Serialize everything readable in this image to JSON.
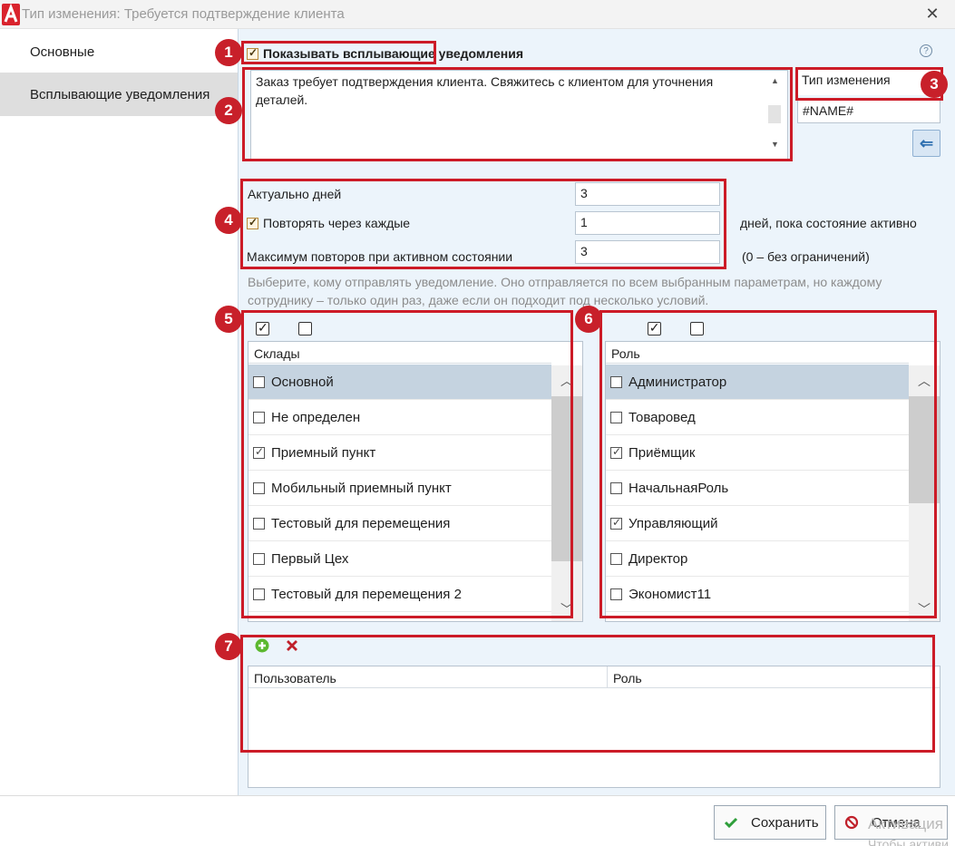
{
  "window": {
    "title": "Тип изменения: Требуется подтверждение клиента",
    "close_glyph": "✕"
  },
  "nav": {
    "items": [
      {
        "label": "Основные"
      },
      {
        "label": "Всплывающие уведомления"
      }
    ]
  },
  "main": {
    "show_popups_label": "Показывать всплывающие уведомления",
    "show_popups_checked": true,
    "help_glyph": "?",
    "message_text": "Заказ требует подтверждения клиента. Свяжитесь с клиентом для уточнения деталей.",
    "field_list": [
      "Тип изменения",
      "#NAME#"
    ],
    "insert_glyph": "⇐",
    "actual_days_label": "Актуально дней",
    "actual_days_value": "3",
    "repeat_label": "Повторять через каждые",
    "repeat_checked": true,
    "repeat_value": "1",
    "repeat_suffix": "дней, пока состояние активно",
    "max_repeats_label": "Максимум повторов при активном состоянии",
    "max_repeats_value": "3",
    "max_repeats_hint": "(0 – без ограничений)",
    "recipients_hint_line1": "Выберите, кому отправлять уведомление. Оно отправляется по всем выбранным параметрам, но каждому",
    "recipients_hint_line2": "сотруднику – только один раз, даже если он подходит под несколько условий."
  },
  "warehouses": {
    "header": "Склады",
    "rows": [
      {
        "label": "Основной",
        "checked": false,
        "selected": true
      },
      {
        "label": "Не определен",
        "checked": false
      },
      {
        "label": "Приемный пункт",
        "checked": true
      },
      {
        "label": "Мобильный приемный пункт",
        "checked": false
      },
      {
        "label": "Тестовый для перемещения",
        "checked": false
      },
      {
        "label": "Первый Цех",
        "checked": false
      },
      {
        "label": "Тестовый для перемещения 2",
        "checked": false
      }
    ]
  },
  "roles": {
    "header": "Роль",
    "rows": [
      {
        "label": "Администратор",
        "checked": false,
        "selected": true
      },
      {
        "label": "Товаровед",
        "checked": false
      },
      {
        "label": "Приёмщик",
        "checked": true
      },
      {
        "label": "НачальнаяРоль",
        "checked": false
      },
      {
        "label": "Управляющий",
        "checked": true
      },
      {
        "label": "Директор",
        "checked": false
      },
      {
        "label": "Экономист11",
        "checked": false
      }
    ]
  },
  "users": {
    "columns": [
      "Пользователь",
      "Роль"
    ]
  },
  "footer": {
    "save_label": "Сохранить",
    "cancel_label": "Отмена",
    "watermark_line1": "Активация",
    "watermark_line2": "Чтобы активи"
  },
  "badges": [
    "1",
    "2",
    "3",
    "4",
    "5",
    "6",
    "7"
  ],
  "colors": {
    "highlight": "#cc1b27",
    "badge": "#c8202a",
    "panel_bg": "#ecf4fb",
    "selected_row": "#c5d3e0",
    "add_icon": "#5cb830",
    "delete_icon": "#c0202a"
  },
  "icons": {
    "app_logo": "app-logo-icon",
    "close": "close-icon",
    "help": "help-icon",
    "insert": "insert-field-icon",
    "add": "add-icon",
    "delete": "delete-icon",
    "save": "checkmark-icon",
    "cancel": "cancel-icon"
  }
}
